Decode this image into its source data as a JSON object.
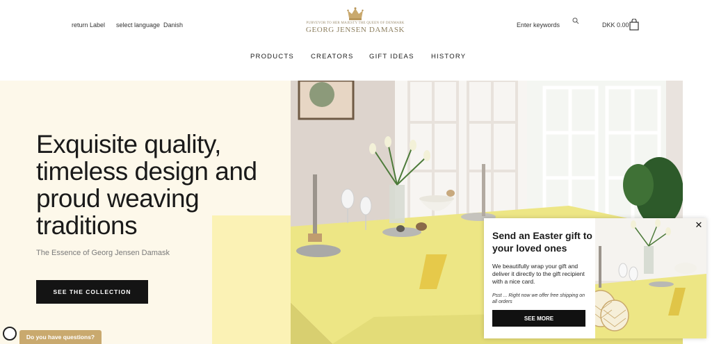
{
  "header": {
    "return_label": "return Label",
    "select_language": "select language",
    "language": "Danish",
    "logo_subtitle": "PURVEYOR TO HER MAJESTY THE QUEEN OF DENMARK",
    "logo_name": "GEORG JENSEN DAMASK",
    "search_placeholder": "Enter keywords",
    "cart_total": "DKK 0.00",
    "icons": {
      "search": "search-icon",
      "cart": "shopping-bag-icon",
      "logo": "crown-icon"
    }
  },
  "nav": [
    "PRODUCTS",
    "CREATORS",
    "GIFT IDEAS",
    "HISTORY"
  ],
  "hero": {
    "title": "Exquisite quality, timeless design and proud weaving traditions",
    "subtitle": "The Essence of Georg Jensen Damask",
    "button": "SEE THE COLLECTION"
  },
  "popup": {
    "title": "Send an Easter gift to your loved ones",
    "body": "We beautifully wrap your gift and deliver it  directly to the gift recipient with a nice card.",
    "note": "Psst ... Right now we offer free shipping on all orders",
    "button": "SEE MORE",
    "close": "✕"
  },
  "chat": {
    "label": "Do you have questions?"
  },
  "colors": {
    "accent": "#c9a96e",
    "hero_bg": "#fdf8ea",
    "hero_yellow": "#fbf2b5",
    "tablecloth": "#ede685"
  }
}
